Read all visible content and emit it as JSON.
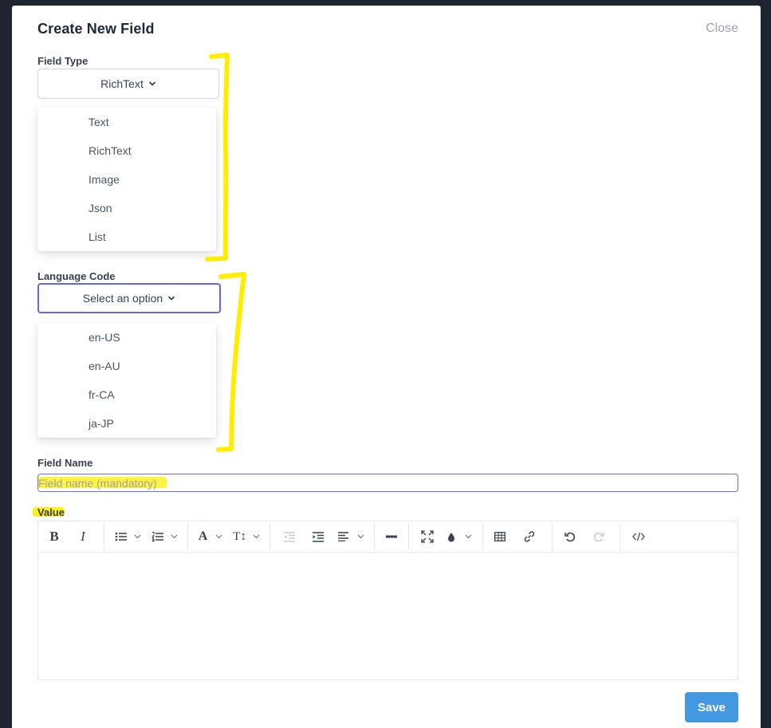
{
  "modal": {
    "title": "Create New Field",
    "close_label": "Close"
  },
  "field_type": {
    "label": "Field Type",
    "selected": "RichText",
    "options": [
      "Text",
      "RichText",
      "Image",
      "Json",
      "List"
    ]
  },
  "language_code": {
    "label": "Language Code",
    "selected": "Select an option",
    "options": [
      "en-US",
      "en-AU",
      "fr-CA",
      "ja-JP"
    ]
  },
  "field_name": {
    "label": "Field Name",
    "placeholder": "Field name (mandatory)",
    "value": ""
  },
  "value_editor": {
    "label": "Value",
    "toolbar": [
      "bold-icon",
      "italic-icon",
      "bullet-list-icon",
      "numbered-list-icon",
      "font-color-icon",
      "font-size-icon",
      "outdent-icon",
      "indent-icon",
      "align-icon",
      "horizontal-rule-icon",
      "fullscreen-icon",
      "highlight-icon",
      "table-icon",
      "link-icon",
      "undo-icon",
      "redo-icon",
      "source-code-icon"
    ],
    "content": ""
  },
  "footer": {
    "save_label": "Save"
  },
  "colors": {
    "annotation": "#ffee00",
    "primary": "#4299e1",
    "focus": "#6366f1"
  }
}
